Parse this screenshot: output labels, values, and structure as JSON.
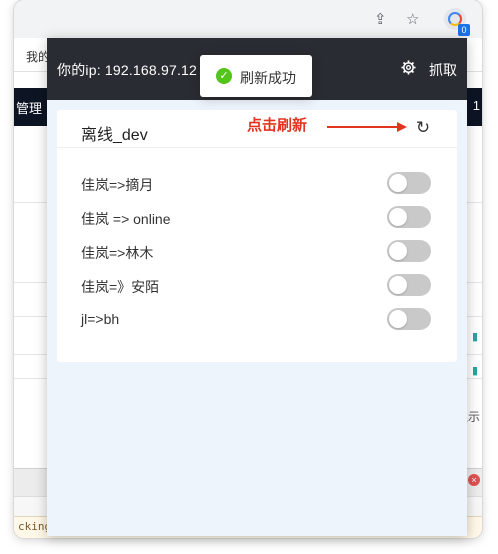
{
  "browser": {
    "bookmark_label": "我的",
    "page_nav_left": "管理",
    "page_nav_right": "1",
    "side_text": "显示",
    "bottom_code": "cking",
    "bottom_close": "×",
    "extension_badge": "0",
    "icons": [
      "share-icon",
      "star-icon",
      "extension-icon"
    ]
  },
  "popup": {
    "ip_text": "你的ip: 192.168.97.12",
    "settings_icon": "gear-icon",
    "grab_label": "抓取",
    "card": {
      "title": "离线_dev",
      "annotation": "点击刷新",
      "refresh_icon": "refresh-icon",
      "rows": [
        {
          "label": "佳岚=>摘月",
          "enabled": false
        },
        {
          "label": "佳岚 => online",
          "enabled": false
        },
        {
          "label": "佳岚=>林木",
          "enabled": false
        },
        {
          "label": "佳岚=》安陌",
          "enabled": false
        },
        {
          "label": "jl=>bh",
          "enabled": false
        }
      ]
    }
  },
  "toast": {
    "message": "刷新成功",
    "status_icon": "success-check-icon"
  },
  "colors": {
    "header_bg": "#2a2c33",
    "popup_bg": "#eef4fc",
    "annotation_red": "#e23420",
    "toggle_off": "#c9c9c9",
    "success_green": "#52c41a"
  }
}
